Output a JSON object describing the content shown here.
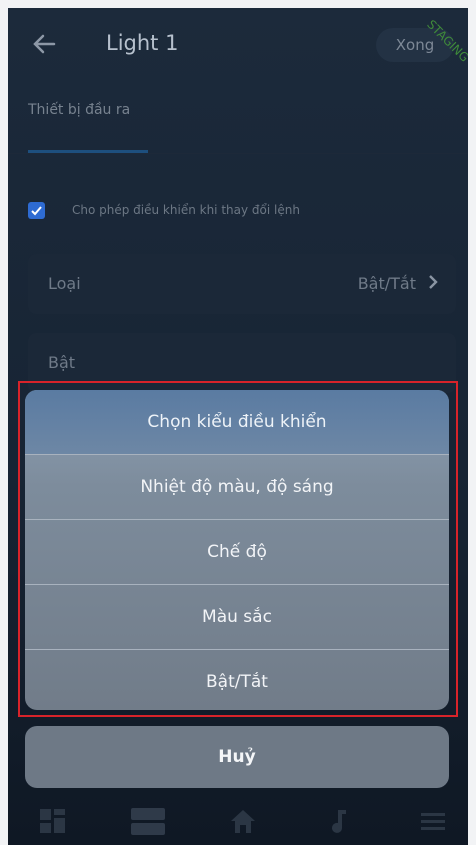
{
  "appbar": {
    "title": "Light 1",
    "save_label": "Xong",
    "env_badge": "STAGING"
  },
  "tab": {
    "label": "Thiết bị đầu ra"
  },
  "checkbox": {
    "label": "Cho phép điều khiển khi thay đổi lệnh",
    "checked": true
  },
  "fields": [
    {
      "label": "Loại",
      "value": "Bật/Tắt"
    },
    {
      "label": "Bật"
    }
  ],
  "action_sheet": {
    "header": "Chọn kiểu điều khiển",
    "options": [
      "Nhiệt độ màu, độ sáng",
      "Chế độ",
      "Màu sắc",
      "Bật/Tắt"
    ],
    "cancel_label": "Huỷ"
  },
  "bottom_nav": {
    "items": [
      "grid-icon",
      "panels-icon",
      "home-icon",
      "music-icon",
      "menu-icon"
    ]
  },
  "colors": {
    "accent": "#2e6bd2",
    "highlight_border": "#d8232a"
  }
}
